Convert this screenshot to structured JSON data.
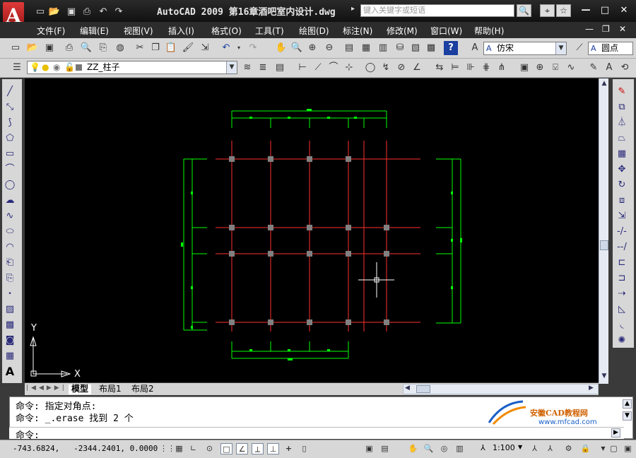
{
  "app": {
    "logo_letter": "A",
    "title": "AutoCAD 2009  第16章酒吧室内设计.dwg",
    "search_placeholder": "键入关键字或短语",
    "window_controls": {
      "minimize": "—",
      "maximize": "□",
      "close": "✕"
    },
    "doc_controls": {
      "minimize": "—",
      "restore": "❐",
      "close": "✕"
    }
  },
  "menu": [
    "文件(F)",
    "编辑(E)",
    "视图(V)",
    "插入(I)",
    "格式(O)",
    "工具(T)",
    "绘图(D)",
    "标注(N)",
    "修改(M)",
    "窗口(W)",
    "帮助(H)"
  ],
  "toolbar": {
    "text_style": "仿宋",
    "dim_style": "圆点",
    "layer": "ZZ_柱子"
  },
  "axes": {
    "x": "X",
    "y": "Y"
  },
  "layout_tabs": [
    "模型",
    "布局1",
    "布局2"
  ],
  "command": {
    "history": [
      "命令: 指定对角点:",
      "命令: _.erase 找到 2 个"
    ],
    "prompt": "命令:"
  },
  "watermark": {
    "brand": "安徽CAD教程网",
    "url": "www.mfcad.com"
  },
  "status": {
    "coordinates": "-743.6824,   -2344.2401, 0.0000",
    "annotation_scale": "1:100"
  },
  "colors": {
    "canvas_bg": "#000000",
    "axis_lines": "#ff3030",
    "dimension_lines": "#00ff00",
    "columns": "#808080",
    "crosshair": "#ffffff"
  }
}
